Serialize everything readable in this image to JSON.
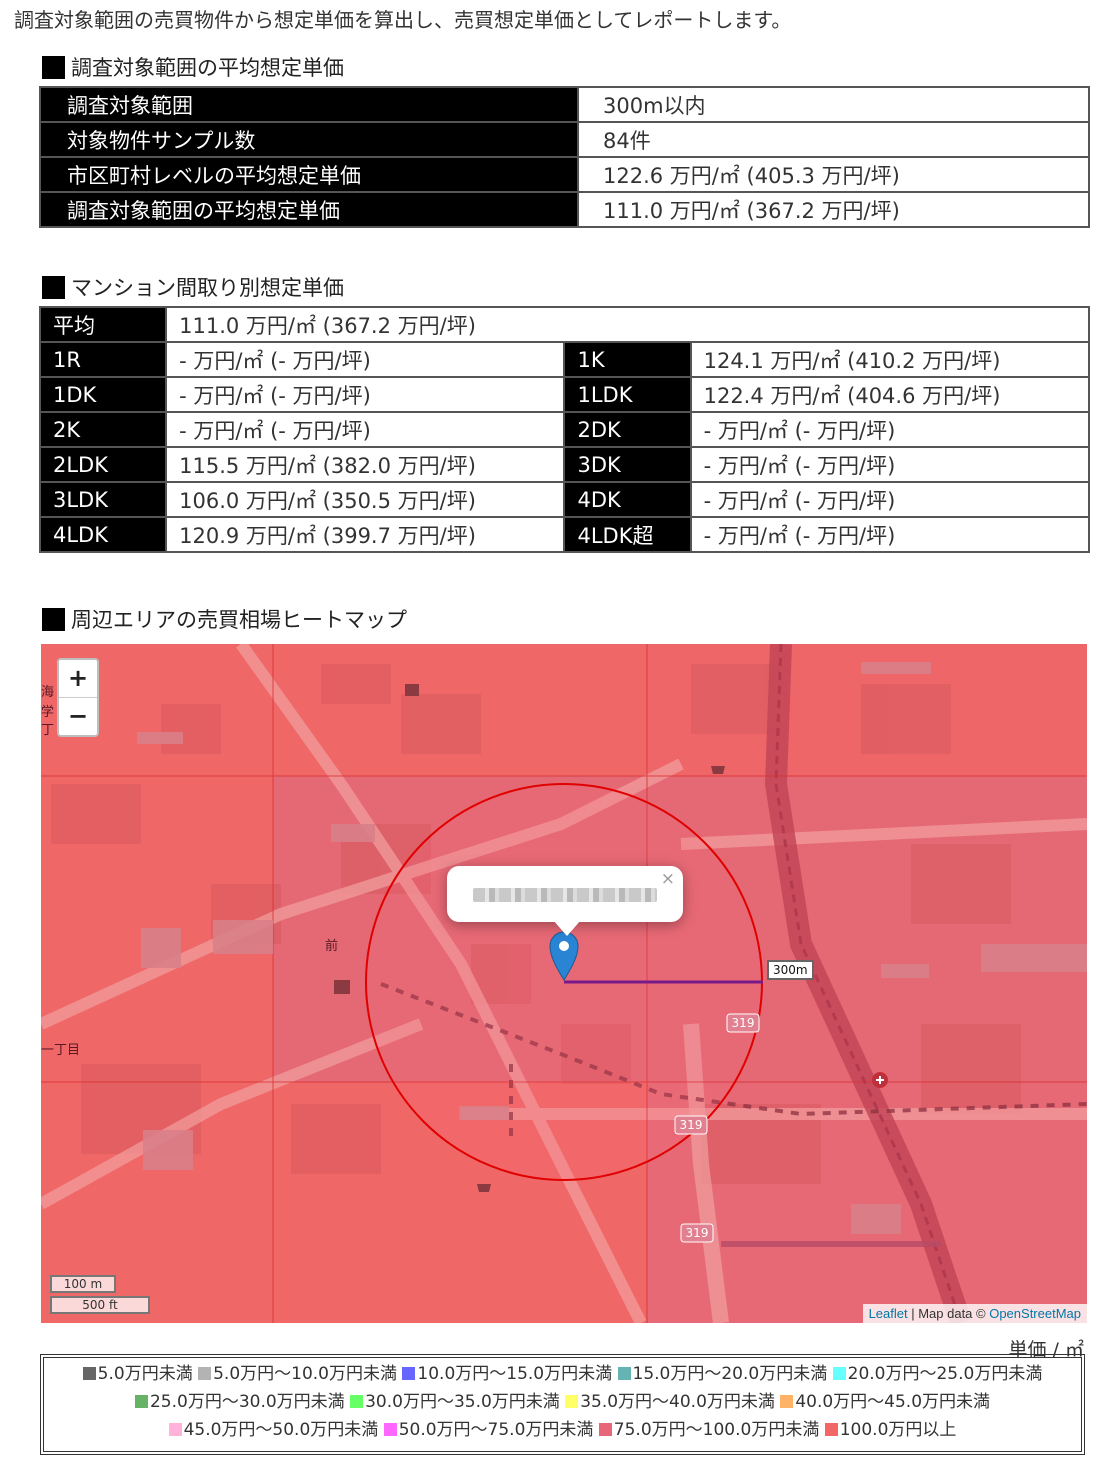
{
  "intro": "調査対象範囲の売買物件から想定単価を算出し、売買想定単価としてレポートします。",
  "section1": {
    "title": "調査対象範囲の平均想定単価",
    "rows": [
      {
        "label": "調査対象範囲",
        "value": "300m以内"
      },
      {
        "label": "対象物件サンプル数",
        "value": "84件"
      },
      {
        "label": "市区町村レベルの平均想定単価",
        "value": "122.6 万円/㎡ (405.3 万円/坪)"
      },
      {
        "label": "調査対象範囲の平均想定単価",
        "value": "111.0 万円/㎡ (367.2 万円/坪)"
      }
    ]
  },
  "section2": {
    "title": "マンション間取り別想定単価",
    "average": {
      "label": "平均",
      "value": "111.0 万円/㎡ (367.2 万円/坪)"
    },
    "rows": [
      [
        {
          "label": "1R",
          "value": "- 万円/㎡ (- 万円/坪)"
        },
        {
          "label": "1K",
          "value": "124.1 万円/㎡ (410.2 万円/坪)"
        }
      ],
      [
        {
          "label": "1DK",
          "value": "- 万円/㎡ (- 万円/坪)"
        },
        {
          "label": "1LDK",
          "value": "122.4 万円/㎡ (404.6 万円/坪)"
        }
      ],
      [
        {
          "label": "2K",
          "value": "- 万円/㎡ (- 万円/坪)"
        },
        {
          "label": "2DK",
          "value": "- 万円/㎡ (- 万円/坪)"
        }
      ],
      [
        {
          "label": "2LDK",
          "value": "115.5 万円/㎡ (382.0 万円/坪)"
        },
        {
          "label": "3DK",
          "value": "- 万円/㎡ (- 万円/坪)"
        }
      ],
      [
        {
          "label": "3LDK",
          "value": "106.0 万円/㎡ (350.5 万円/坪)"
        },
        {
          "label": "4DK",
          "value": "- 万円/㎡ (- 万円/坪)"
        }
      ],
      [
        {
          "label": "4LDK",
          "value": "120.9 万円/㎡ (399.7 万円/坪)"
        },
        {
          "label": "4LDK超",
          "value": "- 万円/㎡ (- 万円/坪)"
        }
      ]
    ]
  },
  "section3": {
    "title": "周辺エリアの売買相場ヒートマップ",
    "map": {
      "zoom_in": "+",
      "zoom_out": "−",
      "popup_close": "×",
      "radius_label": "300m",
      "scale_metric": "100 m",
      "scale_imperial": "500 ft",
      "attribution_leaflet": "Leaflet",
      "attribution_sep": " | Map data © ",
      "attribution_osm": "OpenStreetMap",
      "road_labels": [
        "319",
        "319",
        "319"
      ],
      "place_labels": [
        "前",
        "一丁目",
        "海",
        "学",
        "丁"
      ]
    },
    "unit": "単価 / ㎡",
    "legend": [
      {
        "label": "5.0万円未満",
        "color": "#666666"
      },
      {
        "label": "5.0万円〜10.0万円未満",
        "color": "#b3b3b3"
      },
      {
        "label": "10.0万円〜15.0万円未満",
        "color": "#6666ff"
      },
      {
        "label": "15.0万円〜20.0万円未満",
        "color": "#66b3b3"
      },
      {
        "label": "20.0万円〜25.0万円未満",
        "color": "#66ffff"
      },
      {
        "label": "25.0万円〜30.0万円未満",
        "color": "#66b366"
      },
      {
        "label": "30.0万円〜35.0万円未満",
        "color": "#66ff66"
      },
      {
        "label": "35.0万円〜40.0万円未満",
        "color": "#ffff66"
      },
      {
        "label": "40.0万円〜45.0万円未満",
        "color": "#ffb366"
      },
      {
        "label": "45.0万円〜50.0万円未満",
        "color": "#ffb3d9"
      },
      {
        "label": "50.0万円〜75.0万円未満",
        "color": "#ff66ff"
      },
      {
        "label": "75.0万円〜100.0万円未満",
        "color": "#e8667a"
      },
      {
        "label": "100.0万円以上",
        "color": "#f26666"
      }
    ]
  }
}
